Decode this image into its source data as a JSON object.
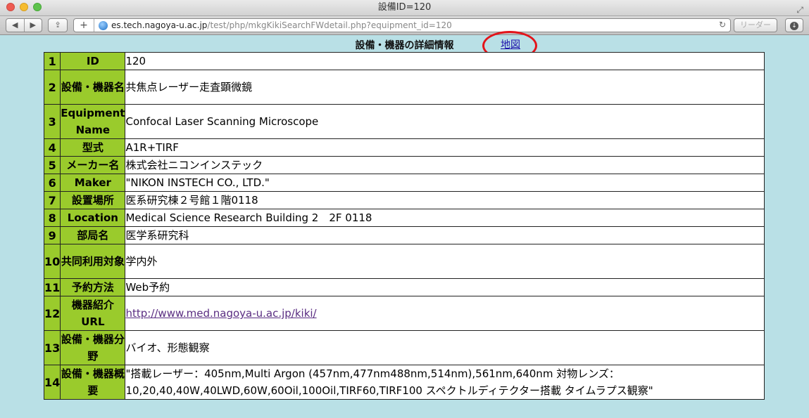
{
  "window": {
    "title": "設備ID=120"
  },
  "toolbar": {
    "back_icon": "◀",
    "forward_icon": "▶",
    "url_host": "es.tech.nagoya-u.ac.jp",
    "url_path": "/test/php/mkgKikiSearchFWdetail.php?equipment_id=120",
    "reader_label": "リーダー"
  },
  "page": {
    "heading": "設備・機器の詳細情報",
    "map_link": "地図",
    "rows": [
      {
        "num": "1",
        "label": "ID",
        "value": "120"
      },
      {
        "num": "2",
        "label": "設備・機器名",
        "value": "共焦点レーザー走査顕微鏡"
      },
      {
        "num": "3",
        "label": "Equipment Name",
        "value": "Confocal Laser Scanning Microscope"
      },
      {
        "num": "4",
        "label": "型式",
        "value": "A1R+TIRF"
      },
      {
        "num": "5",
        "label": "メーカー名",
        "value": "株式会社ニコンインステック"
      },
      {
        "num": "6",
        "label": "Maker",
        "value": "\"NIKON INSTECH CO., LTD.\""
      },
      {
        "num": "7",
        "label": "設置場所",
        "value": "医系研究棟２号館１階0118"
      },
      {
        "num": "8",
        "label": "Location",
        "value": "Medical Science Research Building 2　2F 0118"
      },
      {
        "num": "9",
        "label": "部局名",
        "value": "医学系研究科"
      },
      {
        "num": "10",
        "label": "共同利用対象",
        "value": "学内外"
      },
      {
        "num": "11",
        "label": "予約方法",
        "value": "Web予約"
      },
      {
        "num": "12",
        "label": "機器紹介URL",
        "value": "http://www.med.nagoya-u.ac.jp/kiki/"
      },
      {
        "num": "13",
        "label": "設備・機器分野",
        "value": "バイオ、形態観察"
      },
      {
        "num": "14",
        "label": "設備・機器概要",
        "value": "\"搭載レーザー：405nm,Multi Argon (457nm,477nm488nm,514nm),561nm,640nm 対物レンズ：10,20,40,40W,40LWD,60W,60Oil,100Oil,TIRF60,TIRF100 スペクトルディテクター搭載 タイムラプス観察\""
      }
    ]
  }
}
